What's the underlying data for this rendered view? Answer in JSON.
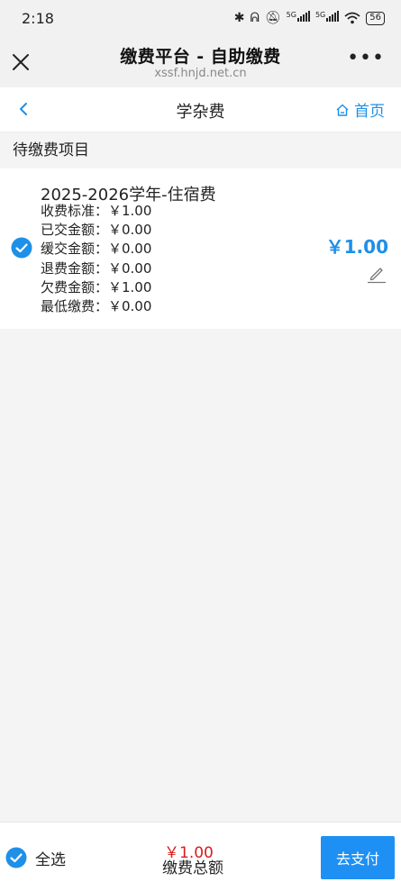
{
  "status_bar": {
    "time": "2:18",
    "network_1": "5G",
    "network_2": "5G",
    "battery": "56"
  },
  "webview": {
    "title": "缴费平台 - 自助缴费",
    "url": "xssf.hnjd.net.cn"
  },
  "nav": {
    "title": "学杂费",
    "home_label": "首页"
  },
  "section": {
    "label": "待缴费项目"
  },
  "item": {
    "title": "2025-2026学年-住宿费",
    "lines": [
      "收费标准：￥1.00",
      "已交金额：￥0.00",
      "缓交金额：￥0.00",
      "退费金额：￥0.00",
      "欠费金额：￥1.00",
      "最低缴费：￥0.00"
    ],
    "amount": "￥1.00",
    "checked": true
  },
  "bottom": {
    "select_all_label": "全选",
    "total_amount": "￥1.00",
    "total_label": "缴费总额",
    "pay_button": "去支付"
  },
  "colors": {
    "accent": "#1e90e8",
    "total_red": "#d91c1c",
    "pay_button_bg": "#1e90f4",
    "page_bg": "#f4f4f4"
  }
}
